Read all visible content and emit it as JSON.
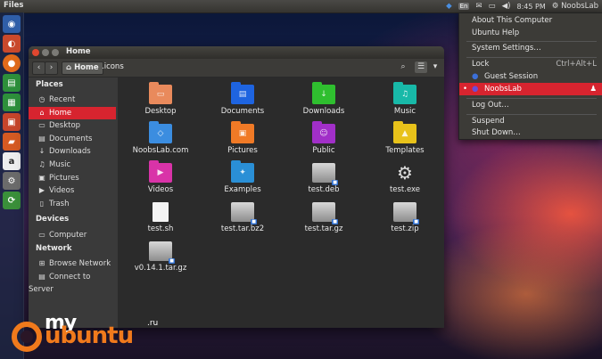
{
  "top_panel": {
    "title": "Files",
    "lang": "En",
    "time": "8:45 PM",
    "user": "NoobsLab"
  },
  "window": {
    "title": "Home",
    "breadcrumb": [
      "Home",
      ".icons"
    ]
  },
  "sidebar": {
    "places_header": "Places",
    "places": [
      {
        "label": "Recent",
        "icon": "clock-icon"
      },
      {
        "label": "Home",
        "icon": "home-icon",
        "selected": true
      },
      {
        "label": "Desktop",
        "icon": "desktop-icon"
      },
      {
        "label": "Documents",
        "icon": "documents-icon"
      },
      {
        "label": "Downloads",
        "icon": "downloads-icon"
      },
      {
        "label": "Music",
        "icon": "music-icon"
      },
      {
        "label": "Pictures",
        "icon": "pictures-icon"
      },
      {
        "label": "Videos",
        "icon": "videos-icon"
      },
      {
        "label": "Trash",
        "icon": "trash-icon"
      }
    ],
    "devices_header": "Devices",
    "devices": [
      {
        "label": "Computer",
        "icon": "computer-icon"
      }
    ],
    "network_header": "Network",
    "network": [
      {
        "label": "Browse Network",
        "icon": "network-icon"
      },
      {
        "label": "Connect to Server",
        "icon": "server-icon"
      }
    ]
  },
  "files": [
    {
      "label": "Desktop",
      "type": "folder",
      "color": "#e98a5c"
    },
    {
      "label": "Documents",
      "type": "folder",
      "color": "#1e64e0"
    },
    {
      "label": "Downloads",
      "type": "folder",
      "color": "#2fbf2f"
    },
    {
      "label": "Music",
      "type": "folder",
      "color": "#18b9a8"
    },
    {
      "label": "NoobsLab.com",
      "type": "folder",
      "color": "#3b8de0"
    },
    {
      "label": "Pictures",
      "type": "folder",
      "color": "#f07a26"
    },
    {
      "label": "Public",
      "type": "folder",
      "color": "#a12fc8"
    },
    {
      "label": "Templates",
      "type": "folder",
      "color": "#e8c21a"
    },
    {
      "label": "Videos",
      "type": "folder",
      "color": "#d933a8"
    },
    {
      "label": "Examples",
      "type": "folder",
      "color": "#2a8fd6"
    },
    {
      "label": "test.deb",
      "type": "package"
    },
    {
      "label": "test.exe",
      "type": "exe"
    },
    {
      "label": "test.sh",
      "type": "script"
    },
    {
      "label": "test.tar.bz2",
      "type": "package"
    },
    {
      "label": "test.tar.gz",
      "type": "package"
    },
    {
      "label": "test.zip",
      "type": "package"
    },
    {
      "label": "v0.14.1.tar.gz",
      "type": "package"
    }
  ],
  "user_menu": {
    "items": [
      {
        "label": "About This Computer"
      },
      {
        "label": "Ubuntu Help"
      },
      {
        "label": "System Settings…"
      },
      {
        "label": "Lock",
        "shortcut": "Ctrl+Alt+L"
      },
      {
        "label": "Guest Session"
      },
      {
        "label": "NoobsLab"
      },
      {
        "label": "Log Out…"
      },
      {
        "label": "Suspend"
      },
      {
        "label": "Shut Down…"
      }
    ]
  },
  "watermark": {
    "my": "my",
    "ubuntu": "ubuntu",
    ".ru": ".ru"
  },
  "colors": {
    "accent": "#d7242f",
    "panel": "#3c3b37",
    "content_bg": "#2b2b2b"
  }
}
